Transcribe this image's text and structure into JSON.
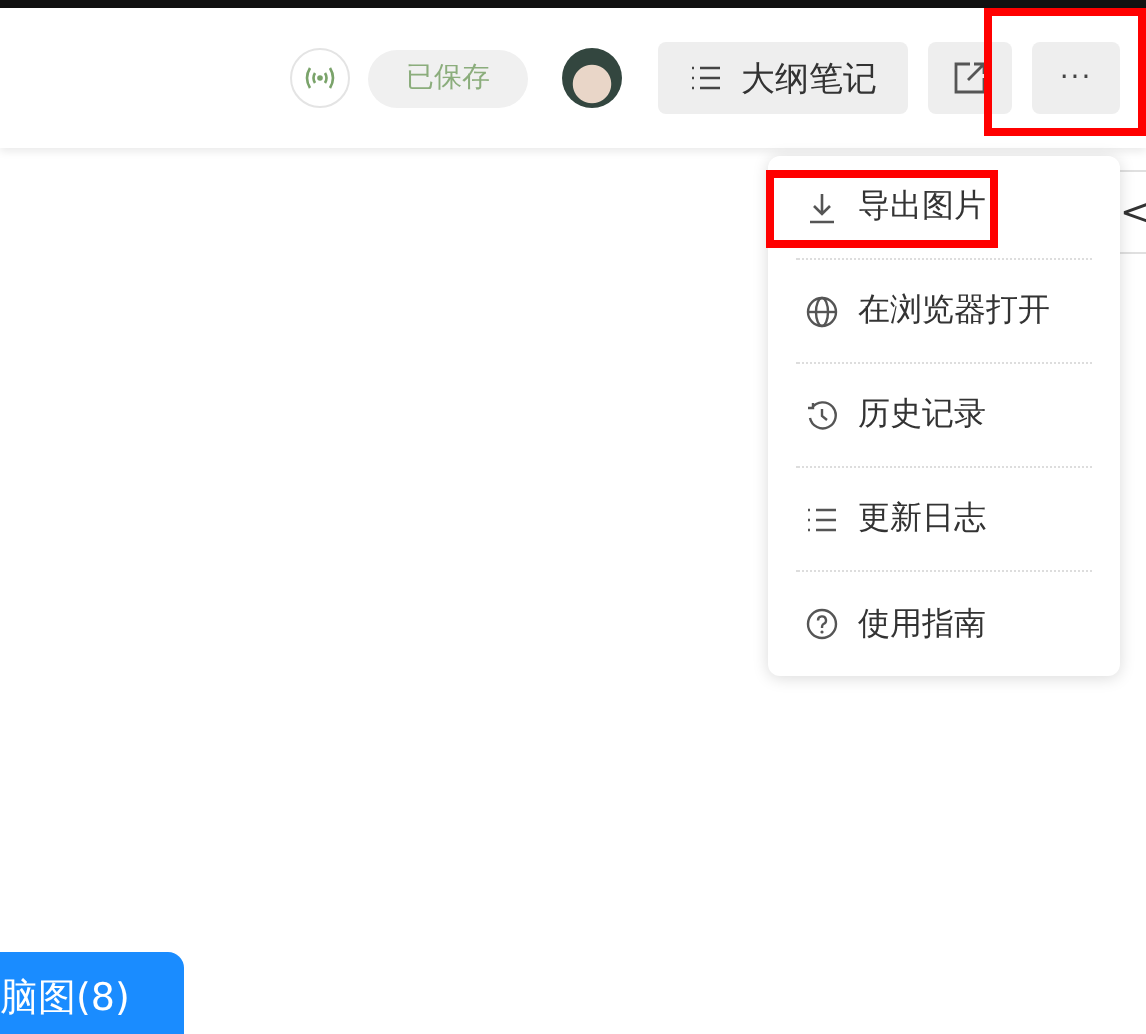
{
  "header": {
    "sync_connected": true,
    "save_status": "已保存",
    "outline_button": "大纲笔记",
    "more_button": {
      "label": "···",
      "highlighted": true
    }
  },
  "menu": {
    "items": [
      {
        "kind": "download",
        "label": "导出图片",
        "highlighted": true
      },
      {
        "kind": "globe",
        "label": "在浏览器打开",
        "highlighted": false
      },
      {
        "kind": "history",
        "label": "历史记录",
        "highlighted": false
      },
      {
        "kind": "list",
        "label": "更新日志",
        "highlighted": false
      },
      {
        "kind": "help",
        "label": "使用指南",
        "highlighted": false
      }
    ]
  },
  "side_panel": {
    "collapse_glyph": "<"
  },
  "bottom_tab": {
    "label": "脑图(8)"
  }
}
